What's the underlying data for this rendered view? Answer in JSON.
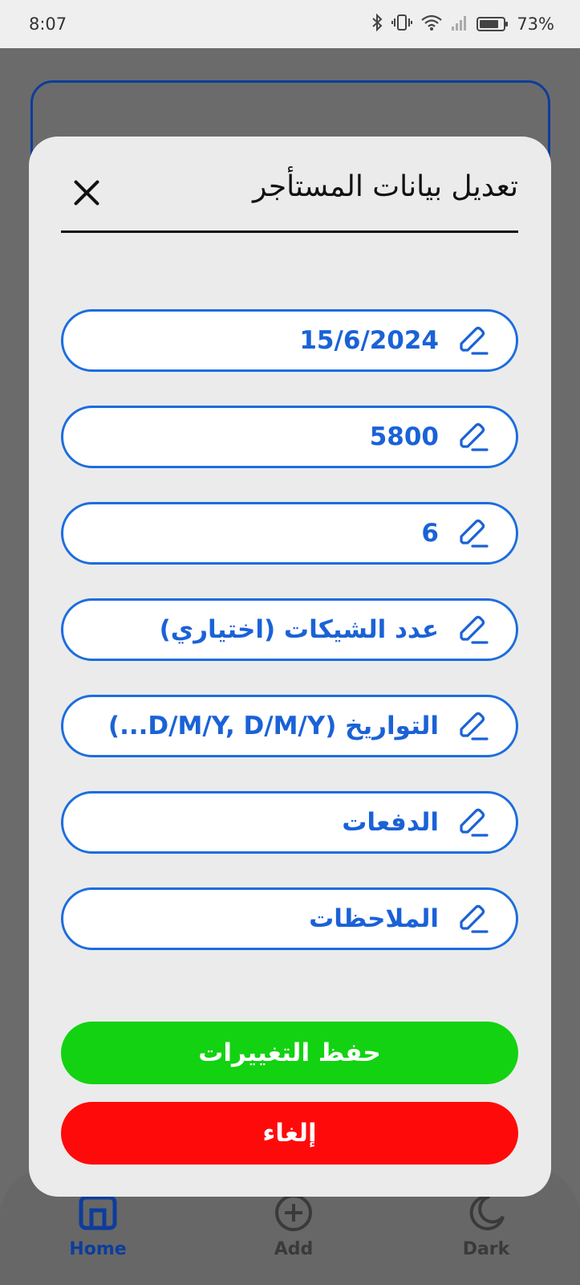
{
  "status_bar": {
    "time": "8:07",
    "battery_percent": "73%",
    "icons": [
      "bluetooth-icon",
      "vibrate-icon",
      "wifi-icon",
      "signal-icon",
      "battery-icon"
    ]
  },
  "modal": {
    "title": "تعديل بيانات المستأجر",
    "close_icon": "close-icon",
    "fields": [
      {
        "value": "15/6/2024",
        "icon": "pencil-icon"
      },
      {
        "value": "5800",
        "icon": "pencil-icon"
      },
      {
        "value": "6",
        "icon": "pencil-icon"
      },
      {
        "value": "عدد الشيكات (اختياري)",
        "icon": "pencil-icon"
      },
      {
        "value": "التواريخ (D/M/Y, D/M/Y...)",
        "icon": "pencil-icon"
      },
      {
        "value": "الدفعات",
        "icon": "pencil-icon"
      },
      {
        "value": "الملاحظات",
        "icon": "pencil-icon"
      }
    ],
    "save_label": "حفظ التغييرات",
    "cancel_label": "إلغاء"
  },
  "bottom_nav": {
    "items": [
      {
        "label": "Home",
        "icon": "home-icon"
      },
      {
        "label": "Add",
        "icon": "add-circle-icon"
      },
      {
        "label": "Dark",
        "icon": "moon-icon"
      }
    ]
  },
  "colors": {
    "accent_blue": "#1c6de0",
    "save_green": "#12d212",
    "cancel_red": "#ff0a0a",
    "nav_active": "#0d3d9c"
  }
}
